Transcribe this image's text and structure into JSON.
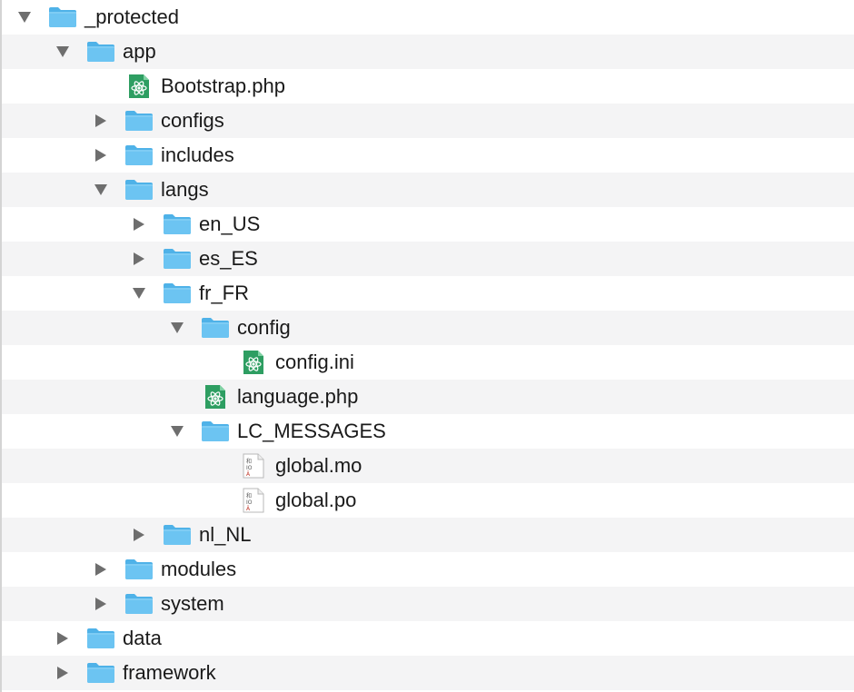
{
  "tree": {
    "items": [
      {
        "label": "_protected",
        "type": "folder",
        "state": "expanded",
        "depth": 0
      },
      {
        "label": "app",
        "type": "folder",
        "state": "expanded",
        "depth": 1
      },
      {
        "label": "Bootstrap.php",
        "type": "php-file",
        "state": "leaf",
        "depth": 2
      },
      {
        "label": "configs",
        "type": "folder",
        "state": "collapsed",
        "depth": 2
      },
      {
        "label": "includes",
        "type": "folder",
        "state": "collapsed",
        "depth": 2
      },
      {
        "label": "langs",
        "type": "folder",
        "state": "expanded",
        "depth": 2
      },
      {
        "label": "en_US",
        "type": "folder",
        "state": "collapsed",
        "depth": 3
      },
      {
        "label": "es_ES",
        "type": "folder",
        "state": "collapsed",
        "depth": 3
      },
      {
        "label": "fr_FR",
        "type": "folder",
        "state": "expanded",
        "depth": 3
      },
      {
        "label": "config",
        "type": "folder",
        "state": "expanded",
        "depth": 4
      },
      {
        "label": "config.ini",
        "type": "php-file",
        "state": "leaf",
        "depth": 5
      },
      {
        "label": "language.php",
        "type": "php-file",
        "state": "leaf",
        "depth": 4
      },
      {
        "label": "LC_MESSAGES",
        "type": "folder",
        "state": "expanded",
        "depth": 4
      },
      {
        "label": "global.mo",
        "type": "gettext-file",
        "state": "leaf",
        "depth": 5
      },
      {
        "label": "global.po",
        "type": "gettext-file",
        "state": "leaf",
        "depth": 5
      },
      {
        "label": "nl_NL",
        "type": "folder",
        "state": "collapsed",
        "depth": 3
      },
      {
        "label": "modules",
        "type": "folder",
        "state": "collapsed",
        "depth": 2
      },
      {
        "label": "system",
        "type": "folder",
        "state": "collapsed",
        "depth": 2
      },
      {
        "label": "data",
        "type": "folder",
        "state": "collapsed",
        "depth": 1
      },
      {
        "label": "framework",
        "type": "folder",
        "state": "collapsed",
        "depth": 1
      }
    ]
  },
  "colors": {
    "folder_body": "#6cc4f2",
    "folder_tab": "#4fb2e8",
    "php_icon_bg": "#2e9e62",
    "row_alt": "#f4f4f5",
    "disclosure": "#6e6e6e"
  },
  "icons": {
    "folder": "folder-icon",
    "php-file": "atom-php-file-icon",
    "gettext-file": "gettext-file-icon",
    "expanded": "triangle-down-icon",
    "collapsed": "triangle-right-icon"
  }
}
